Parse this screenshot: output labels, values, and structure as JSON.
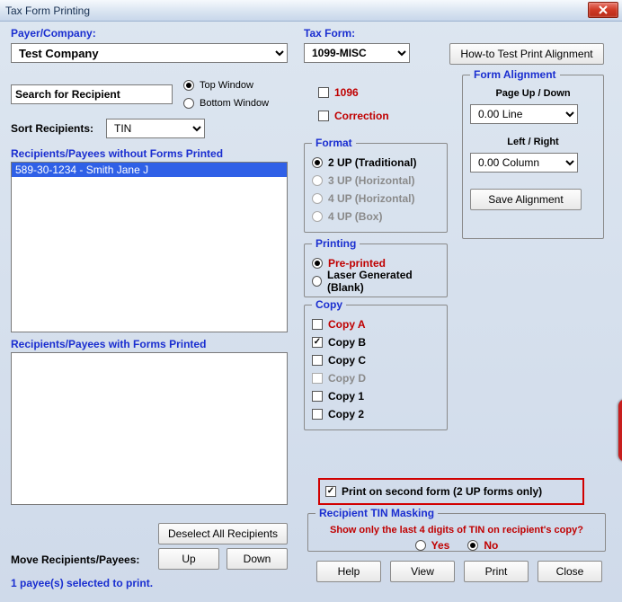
{
  "window": {
    "title": "Tax Form Printing"
  },
  "payer": {
    "label": "Payer/Company:",
    "value": "Test Company"
  },
  "search": {
    "placeholder": "Search for Recipient"
  },
  "window_pos": {
    "top_label": "Top Window",
    "bottom_label": "Bottom Window",
    "selected": "top"
  },
  "sort": {
    "label": "Sort Recipients:",
    "value": "TIN"
  },
  "lists": {
    "without_header": "Recipients/Payees without Forms Printed",
    "without_items": [
      "589-30-1234 - Smith Jane J"
    ],
    "with_header": "Recipients/Payees with Forms Printed"
  },
  "tax_form": {
    "label": "Tax Form:",
    "value": "1099-MISC"
  },
  "howto_btn": "How-to Test Print Alignment",
  "flags": {
    "f1096": "1096",
    "correction": "Correction"
  },
  "format": {
    "legend": "Format",
    "options": [
      "2 UP (Traditional)",
      "3 UP (Horizontal)",
      "4 UP (Horizontal)",
      "4 UP (Box)"
    ],
    "selected_index": 0
  },
  "printing": {
    "legend": "Printing",
    "options": [
      "Pre-printed",
      "Laser Generated (Blank)"
    ],
    "selected_index": 0
  },
  "copy": {
    "legend": "Copy",
    "items": [
      {
        "label": "Copy A",
        "checked": false,
        "style": "red"
      },
      {
        "label": "Copy B",
        "checked": true,
        "style": "black"
      },
      {
        "label": "Copy C",
        "checked": false,
        "style": "black"
      },
      {
        "label": "Copy D",
        "checked": false,
        "style": "gray"
      },
      {
        "label": "Copy 1",
        "checked": false,
        "style": "black"
      },
      {
        "label": "Copy 2",
        "checked": false,
        "style": "black"
      }
    ]
  },
  "alignment": {
    "legend": "Form Alignment",
    "page_label": "Page Up / Down",
    "page_value": "0.00 Line",
    "lr_label": "Left / Right",
    "lr_value": "0.00 Column",
    "save_btn": "Save  Alignment"
  },
  "print_second": {
    "label": "Print on second form (2 UP forms only)",
    "checked": true
  },
  "tin_mask": {
    "legend": "Recipient TIN Masking",
    "question": "Show only the last 4 digits of TIN on recipient's copy?",
    "yes": "Yes",
    "no": "No",
    "selected": "no"
  },
  "buttons": {
    "deselect": "Deselect All Recipients",
    "move_label": "Move Recipients/Payees:",
    "up": "Up",
    "down": "Down",
    "help": "Help",
    "view": "View",
    "print": "Print",
    "close": "Close"
  },
  "status": "1 payee(s) selected to print."
}
